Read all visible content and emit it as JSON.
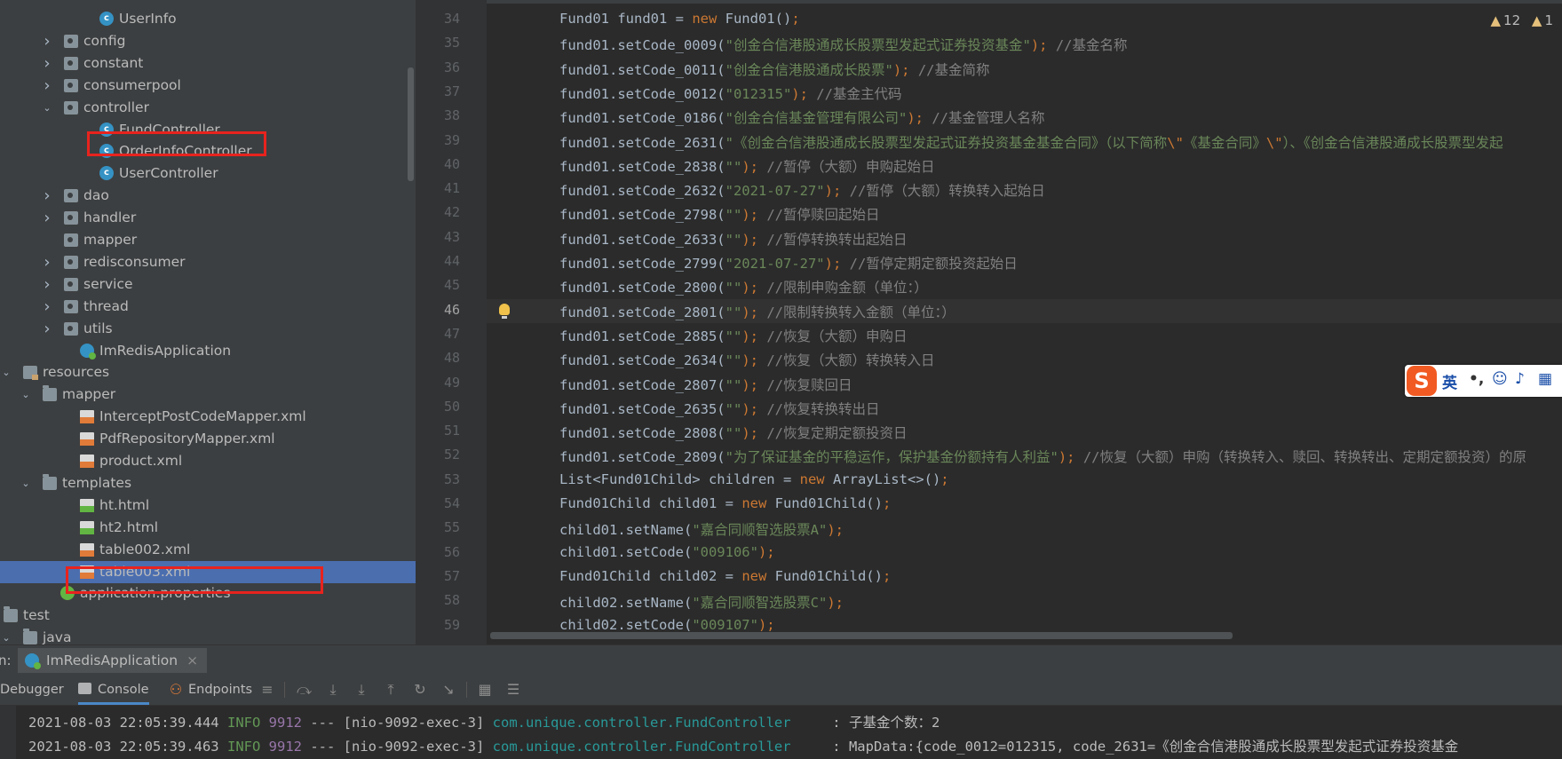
{
  "project_tree": {
    "items": [
      {
        "label": "UserInfo",
        "icon": "class-icon"
      },
      {
        "label": "config",
        "icon": "package-icon"
      },
      {
        "label": "constant",
        "icon": "package-icon"
      },
      {
        "label": "consumerpool",
        "icon": "package-icon"
      },
      {
        "label": "controller",
        "icon": "package-icon"
      },
      {
        "label": "FundController",
        "icon": "class-icon"
      },
      {
        "label": "OrderInfoController",
        "icon": "class-icon"
      },
      {
        "label": "UserController",
        "icon": "class-icon"
      },
      {
        "label": "dao",
        "icon": "package-icon"
      },
      {
        "label": "handler",
        "icon": "package-icon"
      },
      {
        "label": "mapper",
        "icon": "package-icon"
      },
      {
        "label": "redisconsumer",
        "icon": "package-icon"
      },
      {
        "label": "service",
        "icon": "package-icon"
      },
      {
        "label": "thread",
        "icon": "package-icon"
      },
      {
        "label": "utils",
        "icon": "package-icon"
      },
      {
        "label": "ImRedisApplication",
        "icon": "spring-app-icon"
      },
      {
        "label": "resources",
        "icon": "resources-folder-icon"
      },
      {
        "label": "mapper",
        "icon": "folder-icon"
      },
      {
        "label": "InterceptPostCodeMapper.xml",
        "icon": "xml-file-icon"
      },
      {
        "label": "PdfRepositoryMapper.xml",
        "icon": "xml-file-icon"
      },
      {
        "label": "product.xml",
        "icon": "xml-file-icon"
      },
      {
        "label": "templates",
        "icon": "folder-icon"
      },
      {
        "label": "ht.html",
        "icon": "html-file-icon"
      },
      {
        "label": "ht2.html",
        "icon": "html-file-icon"
      },
      {
        "label": "table002.xml",
        "icon": "xml-file-icon"
      },
      {
        "label": "table003.xml",
        "icon": "xml-file-icon"
      },
      {
        "label": "application.properties",
        "icon": "properties-file-icon"
      },
      {
        "label": "test",
        "icon": "folder-icon"
      },
      {
        "label": "java",
        "icon": "folder-icon"
      }
    ]
  },
  "editor": {
    "inspection_warnings": "12",
    "inspection_other": "1",
    "current_line": "46",
    "lines": [
      {
        "num": "34",
        "tokens": [
          {
            "t": "Fund01 fund01 = ",
            "c": "id"
          },
          {
            "t": "new",
            "c": "kw"
          },
          {
            "t": " Fund01()",
            "c": "id"
          },
          {
            "t": ";",
            "c": "kw"
          }
        ]
      },
      {
        "num": "35",
        "tokens": [
          {
            "t": "fund01.setCode_0009(",
            "c": "id"
          },
          {
            "t": "\"创金合信港股通成长股票型发起式证券投资基金\"",
            "c": "str"
          },
          {
            "t": "); ",
            "c": "kw"
          },
          {
            "t": "//基金名称",
            "c": "cmt"
          }
        ]
      },
      {
        "num": "36",
        "tokens": [
          {
            "t": "fund01.setCode_0011(",
            "c": "id"
          },
          {
            "t": "\"创金合信港股通成长股票\"",
            "c": "str"
          },
          {
            "t": "); ",
            "c": "kw"
          },
          {
            "t": "//基金简称",
            "c": "cmt"
          }
        ]
      },
      {
        "num": "37",
        "tokens": [
          {
            "t": "fund01.setCode_0012(",
            "c": "id"
          },
          {
            "t": "\"012315\"",
            "c": "str"
          },
          {
            "t": "); ",
            "c": "kw"
          },
          {
            "t": "//基金主代码",
            "c": "cmt"
          }
        ]
      },
      {
        "num": "38",
        "tokens": [
          {
            "t": "fund01.setCode_0186(",
            "c": "id"
          },
          {
            "t": "\"创金合信基金管理有限公司\"",
            "c": "str"
          },
          {
            "t": "); ",
            "c": "kw"
          },
          {
            "t": "//基金管理人名称",
            "c": "cmt"
          }
        ]
      },
      {
        "num": "39",
        "tokens": [
          {
            "t": "fund01.setCode_2631(",
            "c": "id"
          },
          {
            "t": "\"《创金合信港股通成长股票型发起式证券投资基金基金合同》（以下简称",
            "c": "str"
          },
          {
            "t": "\\\"",
            "c": "kw"
          },
          {
            "t": "《基金合同》",
            "c": "str"
          },
          {
            "t": "\\\"",
            "c": "kw"
          },
          {
            "t": "）、《创金合信港股通成长股票型发起",
            "c": "str"
          }
        ]
      },
      {
        "num": "40",
        "tokens": [
          {
            "t": "fund01.setCode_2838(",
            "c": "id"
          },
          {
            "t": "\"\"",
            "c": "str"
          },
          {
            "t": "); ",
            "c": "kw"
          },
          {
            "t": "//暂停（大额）申购起始日",
            "c": "cmt"
          }
        ]
      },
      {
        "num": "41",
        "tokens": [
          {
            "t": "fund01.setCode_2632(",
            "c": "id"
          },
          {
            "t": "\"2021-07-27\"",
            "c": "str"
          },
          {
            "t": "); ",
            "c": "kw"
          },
          {
            "t": "//暂停（大额）转换转入起始日",
            "c": "cmt"
          }
        ]
      },
      {
        "num": "42",
        "tokens": [
          {
            "t": "fund01.setCode_2798(",
            "c": "id"
          },
          {
            "t": "\"\"",
            "c": "str"
          },
          {
            "t": "); ",
            "c": "kw"
          },
          {
            "t": "//暂停赎回起始日",
            "c": "cmt"
          }
        ]
      },
      {
        "num": "43",
        "tokens": [
          {
            "t": "fund01.setCode_2633(",
            "c": "id"
          },
          {
            "t": "\"\"",
            "c": "str"
          },
          {
            "t": "); ",
            "c": "kw"
          },
          {
            "t": "//暂停转换转出起始日",
            "c": "cmt"
          }
        ]
      },
      {
        "num": "44",
        "tokens": [
          {
            "t": "fund01.setCode_2799(",
            "c": "id"
          },
          {
            "t": "\"2021-07-27\"",
            "c": "str"
          },
          {
            "t": "); ",
            "c": "kw"
          },
          {
            "t": "//暂停定期定额投资起始日",
            "c": "cmt"
          }
        ]
      },
      {
        "num": "45",
        "tokens": [
          {
            "t": "fund01.setCode_2800(",
            "c": "id"
          },
          {
            "t": "\"\"",
            "c": "str"
          },
          {
            "t": "); ",
            "c": "kw"
          },
          {
            "t": "//限制申购金额（单位：）",
            "c": "cmt"
          }
        ]
      },
      {
        "num": "46",
        "tokens": [
          {
            "t": "fund01.setCode_2801(",
            "c": "id"
          },
          {
            "t": "\"\"",
            "c": "str"
          },
          {
            "t": "); ",
            "c": "kw"
          },
          {
            "t": "//限制转换转入金额（单位：）",
            "c": "cmt"
          }
        ]
      },
      {
        "num": "47",
        "tokens": [
          {
            "t": "fund01.setCode_2885(",
            "c": "id"
          },
          {
            "t": "\"\"",
            "c": "str"
          },
          {
            "t": "); ",
            "c": "kw"
          },
          {
            "t": "//恢复（大额）申购日",
            "c": "cmt"
          }
        ]
      },
      {
        "num": "48",
        "tokens": [
          {
            "t": "fund01.setCode_2634(",
            "c": "id"
          },
          {
            "t": "\"\"",
            "c": "str"
          },
          {
            "t": "); ",
            "c": "kw"
          },
          {
            "t": "//恢复（大额）转换转入日",
            "c": "cmt"
          }
        ]
      },
      {
        "num": "49",
        "tokens": [
          {
            "t": "fund01.setCode_2807(",
            "c": "id"
          },
          {
            "t": "\"\"",
            "c": "str"
          },
          {
            "t": "); ",
            "c": "kw"
          },
          {
            "t": "//恢复赎回日",
            "c": "cmt"
          }
        ]
      },
      {
        "num": "50",
        "tokens": [
          {
            "t": "fund01.setCode_2635(",
            "c": "id"
          },
          {
            "t": "\"\"",
            "c": "str"
          },
          {
            "t": "); ",
            "c": "kw"
          },
          {
            "t": "//恢复转换转出日",
            "c": "cmt"
          }
        ]
      },
      {
        "num": "51",
        "tokens": [
          {
            "t": "fund01.setCode_2808(",
            "c": "id"
          },
          {
            "t": "\"\"",
            "c": "str"
          },
          {
            "t": "); ",
            "c": "kw"
          },
          {
            "t": "//恢复定期定额投资日",
            "c": "cmt"
          }
        ]
      },
      {
        "num": "52",
        "tokens": [
          {
            "t": "fund01.setCode_2809(",
            "c": "id"
          },
          {
            "t": "\"为了保证基金的平稳运作，保护基金份额持有人利益\"",
            "c": "str"
          },
          {
            "t": "); ",
            "c": "kw"
          },
          {
            "t": "//恢复（大额）申购（转换转入、赎回、转换转出、定期定额投资）的原",
            "c": "cmt"
          }
        ]
      },
      {
        "num": "53",
        "tokens": [
          {
            "t": "List<Fund01Child> children = ",
            "c": "id"
          },
          {
            "t": "new",
            "c": "kw"
          },
          {
            "t": " ArrayList<>()",
            "c": "id"
          },
          {
            "t": ";",
            "c": "kw"
          }
        ]
      },
      {
        "num": "54",
        "tokens": [
          {
            "t": "Fund01Child child01 = ",
            "c": "id"
          },
          {
            "t": "new",
            "c": "kw"
          },
          {
            "t": " Fund01Child()",
            "c": "id"
          },
          {
            "t": ";",
            "c": "kw"
          }
        ]
      },
      {
        "num": "55",
        "tokens": [
          {
            "t": "child01.setName(",
            "c": "id"
          },
          {
            "t": "\"嘉合同顺智选股票A\"",
            "c": "str"
          },
          {
            "t": ");",
            "c": "kw"
          }
        ]
      },
      {
        "num": "56",
        "tokens": [
          {
            "t": "child01.setCode(",
            "c": "id"
          },
          {
            "t": "\"009106\"",
            "c": "str"
          },
          {
            "t": ");",
            "c": "kw"
          }
        ]
      },
      {
        "num": "57",
        "tokens": [
          {
            "t": "Fund01Child child02 = ",
            "c": "id"
          },
          {
            "t": "new",
            "c": "kw"
          },
          {
            "t": " Fund01Child()",
            "c": "id"
          },
          {
            "t": ";",
            "c": "kw"
          }
        ]
      },
      {
        "num": "58",
        "tokens": [
          {
            "t": "child02.setName(",
            "c": "id"
          },
          {
            "t": "\"嘉合同顺智选股票C\"",
            "c": "str"
          },
          {
            "t": ");",
            "c": "kw"
          }
        ]
      },
      {
        "num": "59",
        "tokens": [
          {
            "t": "child02.setCode(",
            "c": "id"
          },
          {
            "t": "\"009107\"",
            "c": "str"
          },
          {
            "t": ");",
            "c": "kw"
          }
        ]
      }
    ]
  },
  "ime": {
    "logo": "S",
    "lang": "英",
    "punct": "•,"
  },
  "run": {
    "label": "n:",
    "tab": "ImRedisApplication",
    "close": "×"
  },
  "tool_tabs": {
    "debugger": "Debugger",
    "console": "Console",
    "endpoints": "Endpoints"
  },
  "console": {
    "lines": [
      {
        "ts": "2021-08-03 22:05:39.444",
        "level": "INFO",
        "pid": "9912",
        "sep": "---",
        "thread": "[nio-9092-exec-3]",
        "logger": "com.unique.controller.FundController",
        "msg": ": 子基金个数：2"
      },
      {
        "ts": "2021-08-03 22:05:39.463",
        "level": "INFO",
        "pid": "9912",
        "sep": "---",
        "thread": "[nio-9092-exec-3]",
        "logger": "com.unique.controller.FundController",
        "msg": ": MapData:{code_0012=012315, code_2631=《创金合信港股通成长股票型发起式证券投资基金"
      }
    ]
  }
}
